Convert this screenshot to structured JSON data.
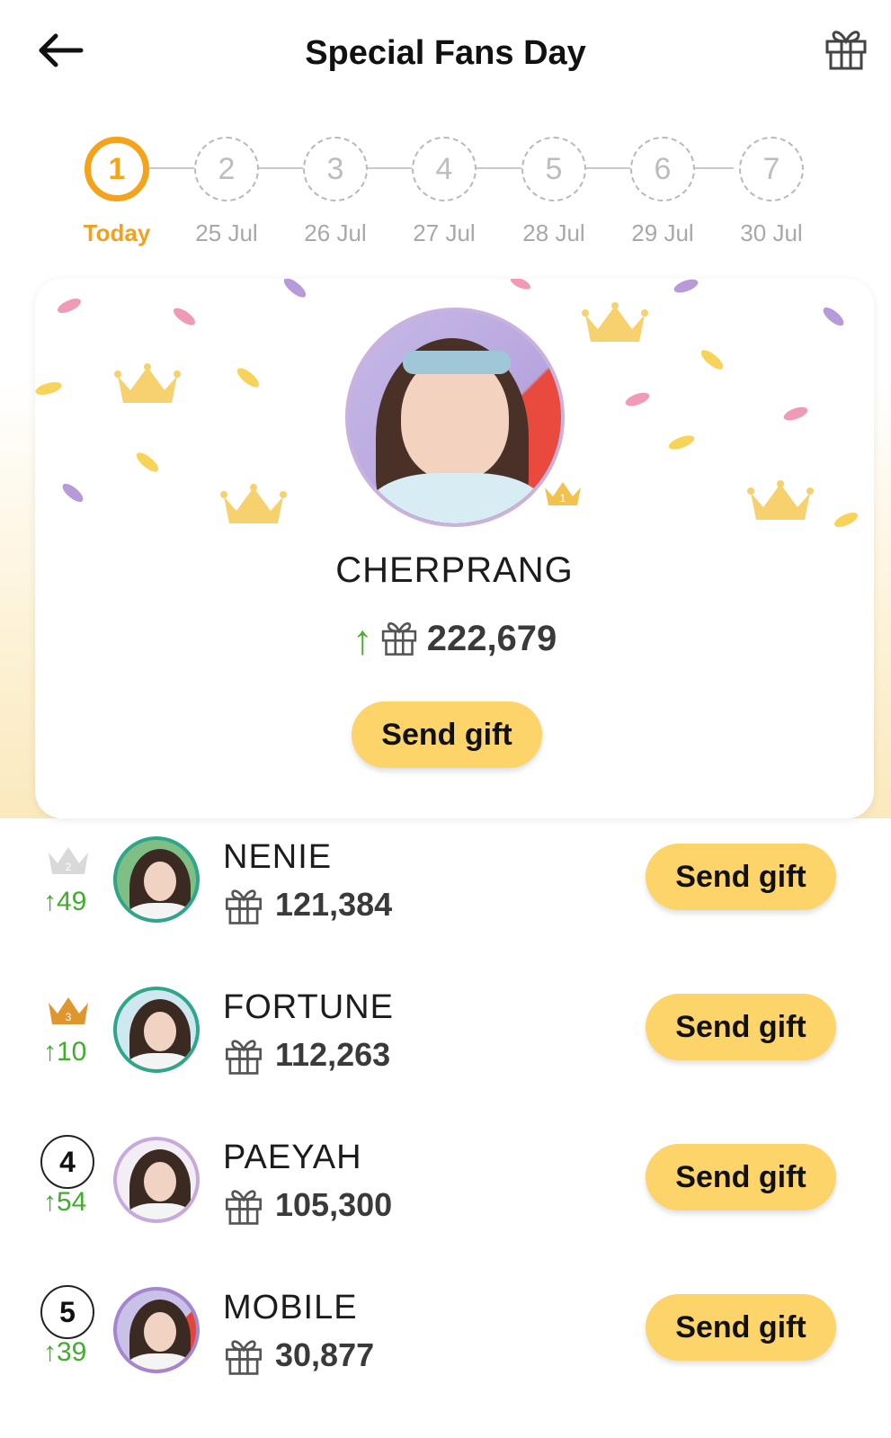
{
  "header": {
    "title": "Special Fans Day",
    "back_icon": "arrow-left-icon",
    "gift_icon": "gift-icon"
  },
  "stepper": {
    "steps": [
      {
        "number": "1",
        "date": "Today",
        "active": true
      },
      {
        "number": "2",
        "date": "25 Jul",
        "active": false
      },
      {
        "number": "3",
        "date": "26 Jul",
        "active": false
      },
      {
        "number": "4",
        "date": "27 Jul",
        "active": false
      },
      {
        "number": "5",
        "date": "28 Jul",
        "active": false
      },
      {
        "number": "6",
        "date": "29 Jul",
        "active": false
      },
      {
        "number": "7",
        "date": "30 Jul",
        "active": false
      }
    ]
  },
  "leader": {
    "name": "CHERPRANG",
    "trend_icon": "arrow-up-icon",
    "score": "222,679",
    "button_label": "Send gift"
  },
  "ranking": [
    {
      "rank_type": "silver-crown",
      "change": "↑49",
      "name": "NENIE",
      "score": "121,384",
      "button_label": "Send gift",
      "ring_color": "#2fa58a"
    },
    {
      "rank_type": "bronze-crown",
      "change": "↑10",
      "name": "FORTUNE",
      "score": "112,263",
      "button_label": "Send gift",
      "ring_color": "#2fa58a"
    },
    {
      "rank_type": "number",
      "rank": "4",
      "change": "↑54",
      "name": "PAEYAH",
      "score": "105,300",
      "button_label": "Send gift",
      "ring_color": "#c8a9dc"
    },
    {
      "rank_type": "number",
      "rank": "5",
      "change": "↑39",
      "name": "MOBILE",
      "score": "30,877",
      "button_label": "Send gift",
      "ring_color": "#a486cf"
    }
  ],
  "colors": {
    "accent": "#f5a31a",
    "button": "#fcd46a",
    "trend_up": "#3fae2a"
  }
}
